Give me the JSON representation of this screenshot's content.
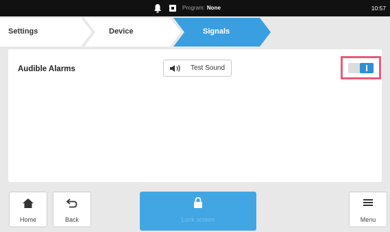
{
  "status": {
    "program_label": "Program:",
    "program_value": "None",
    "time": "10:57"
  },
  "breadcrumb": {
    "items": [
      "Settings",
      "Device",
      "Signals"
    ],
    "active_color": "#3a9fe0"
  },
  "signals": {
    "audible_alarms_label": "Audible Alarms",
    "test_sound_label": "Test Sound",
    "audible_alarms_enabled": true,
    "highlight_color": "#e85a78"
  },
  "bottom": {
    "home_label": "Home",
    "back_label": "Back",
    "lock_label": "Lock screen",
    "menu_label": "Menu"
  },
  "icons": [
    "bell-icon",
    "battery-icon",
    "speaker-icon",
    "home-icon",
    "back-icon",
    "lock-icon",
    "menu-icon"
  ]
}
